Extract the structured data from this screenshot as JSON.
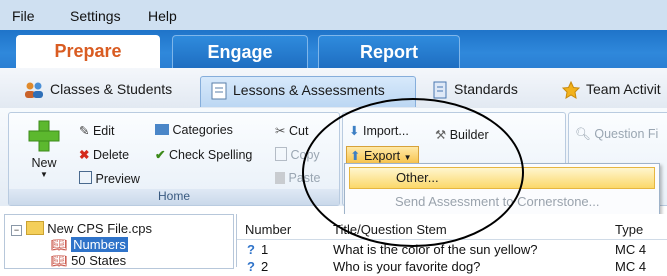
{
  "menu": [
    "File",
    "Settings",
    "Help"
  ],
  "mode_tabs": [
    {
      "label": "Prepare",
      "active": true
    },
    {
      "label": "Engage",
      "active": false
    },
    {
      "label": "Report",
      "active": false
    }
  ],
  "sub_tabs": [
    {
      "label": "Classes & Students",
      "icon": "people-icon"
    },
    {
      "label": "Lessons & Assessments",
      "icon": "document-icon",
      "active": true
    },
    {
      "label": "Standards",
      "icon": "standards-icon"
    },
    {
      "label": "Team Activit",
      "icon": "star-icon"
    }
  ],
  "ribbon": {
    "new_label": "New",
    "edit": "Edit",
    "delete": "Delete",
    "preview": "Preview",
    "categories": "Categories",
    "check_spelling": "Check Spelling",
    "cut": "Cut",
    "copy": "Copy",
    "paste": "Paste",
    "home_group": "Home",
    "import": "Import...",
    "export": "Export",
    "builder": "Builder",
    "question_find": "Question Fi"
  },
  "export_menu": {
    "other": "Other...",
    "send": "Send Assessment to Cornerstone..."
  },
  "tree": {
    "root": "New CPS File.cps",
    "items": [
      "Numbers",
      "50 States"
    ]
  },
  "table": {
    "headers": [
      "Number",
      "Title/Question Stem",
      "Type"
    ],
    "rows": [
      {
        "number": "1",
        "title": "What is the color of the sun yellow?",
        "type": "MC 4"
      },
      {
        "number": "2",
        "title": "Who is your favorite dog?",
        "type": "MC 4"
      }
    ]
  },
  "colors": {
    "accent_orange": "#d95c22",
    "mode_bar_blue": "#2a7fd3",
    "highlight_yellow": "#fbd86a"
  }
}
